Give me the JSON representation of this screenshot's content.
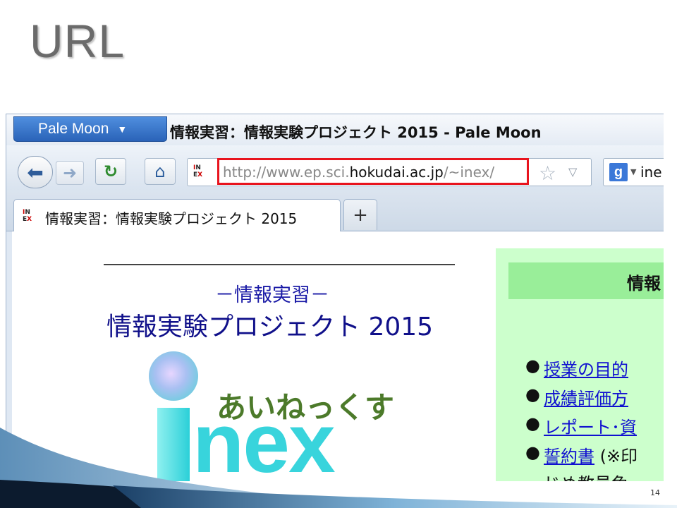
{
  "slide": {
    "title": "URL",
    "page_number": "14"
  },
  "browser": {
    "app_menu_label": "Pale Moon",
    "window_title": "情報実習：情報実験プロジェクト 2015 - Pale Moon",
    "url": {
      "prefix": "http://www.ep.sci.",
      "domain": "hokudai.ac.jp",
      "suffix": "/~inex/"
    },
    "search_text": "ine",
    "tab_label": "情報実習：情報実験プロジェクト 2015",
    "site_icon_text": "IN EX"
  },
  "page": {
    "subtitle": "－情報実習－",
    "title": "情報実験プロジェクト 2015",
    "logo": {
      "nex": "nex",
      "kana": "あいねっくす"
    },
    "sidebar": {
      "title": "情報",
      "links": [
        {
          "link": "授業の目的",
          "rest": ""
        },
        {
          "link": "成績評価方",
          "rest": ""
        },
        {
          "link": "レポート･資",
          "rest": ""
        },
        {
          "link": "誓約書",
          "rest": " (※印"
        }
      ],
      "cut_line": "じめ教員免"
    }
  },
  "colors": {
    "highlight": "#e8141e",
    "link": "#1010d0",
    "sidebar_bg": "#ccffcc"
  }
}
